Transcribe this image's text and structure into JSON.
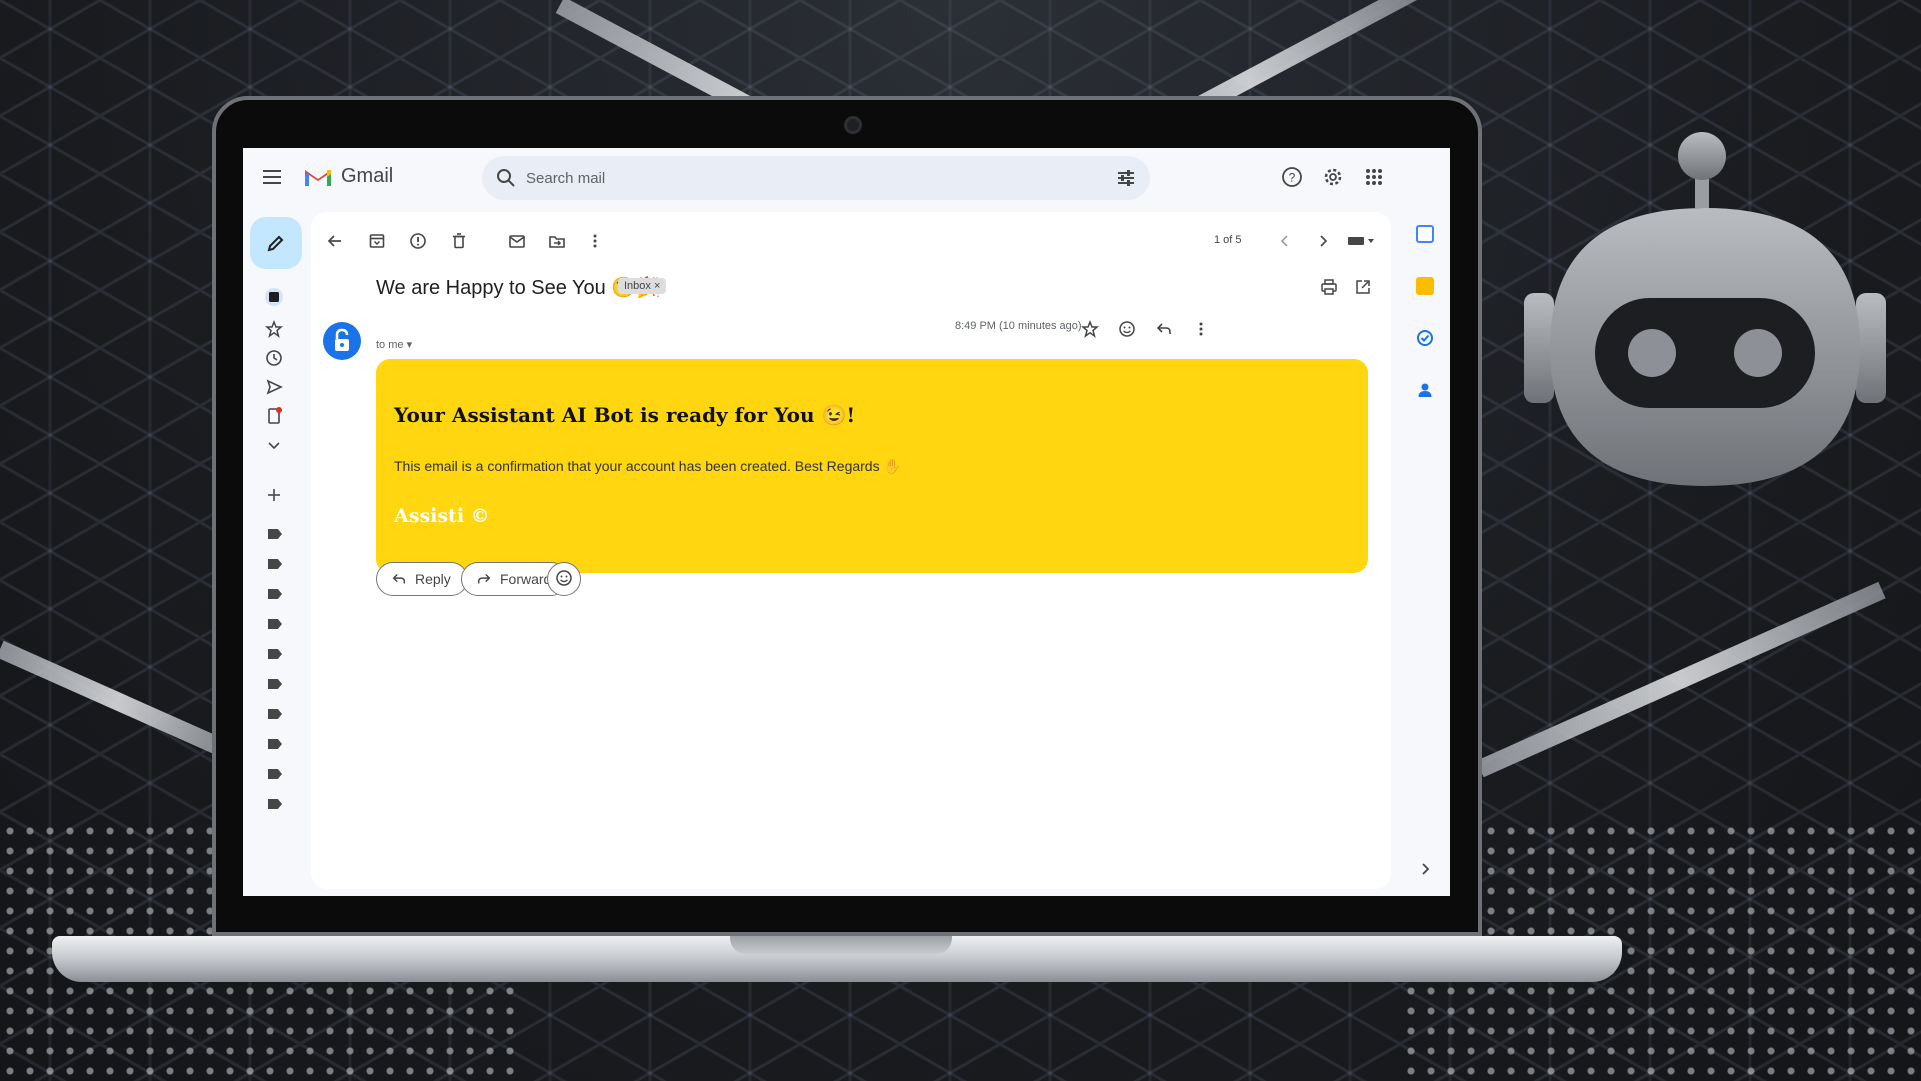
{
  "app": {
    "name": "Gmail"
  },
  "search": {
    "placeholder": "Search mail"
  },
  "toolbar": {
    "pager": "1 of 5"
  },
  "email": {
    "subject": "We are Happy to See You 😉🎉",
    "label_chip": "Inbox ×",
    "time": "8:49 PM (10 minutes ago)",
    "recipient": "to me ▾",
    "card": {
      "title": "Your Assistant AI Bot is ready for You 😉!",
      "body": "This email is a confirmation that your account has been created. Best Regards ✋",
      "signature": "Assisti ©"
    }
  },
  "actions": {
    "reply": "Reply",
    "forward": "Forward"
  },
  "colors": {
    "accent": "#1a73e8",
    "card": "#ffd60f",
    "compose": "#c2e7ff",
    "surface": "#f6f8fc"
  }
}
